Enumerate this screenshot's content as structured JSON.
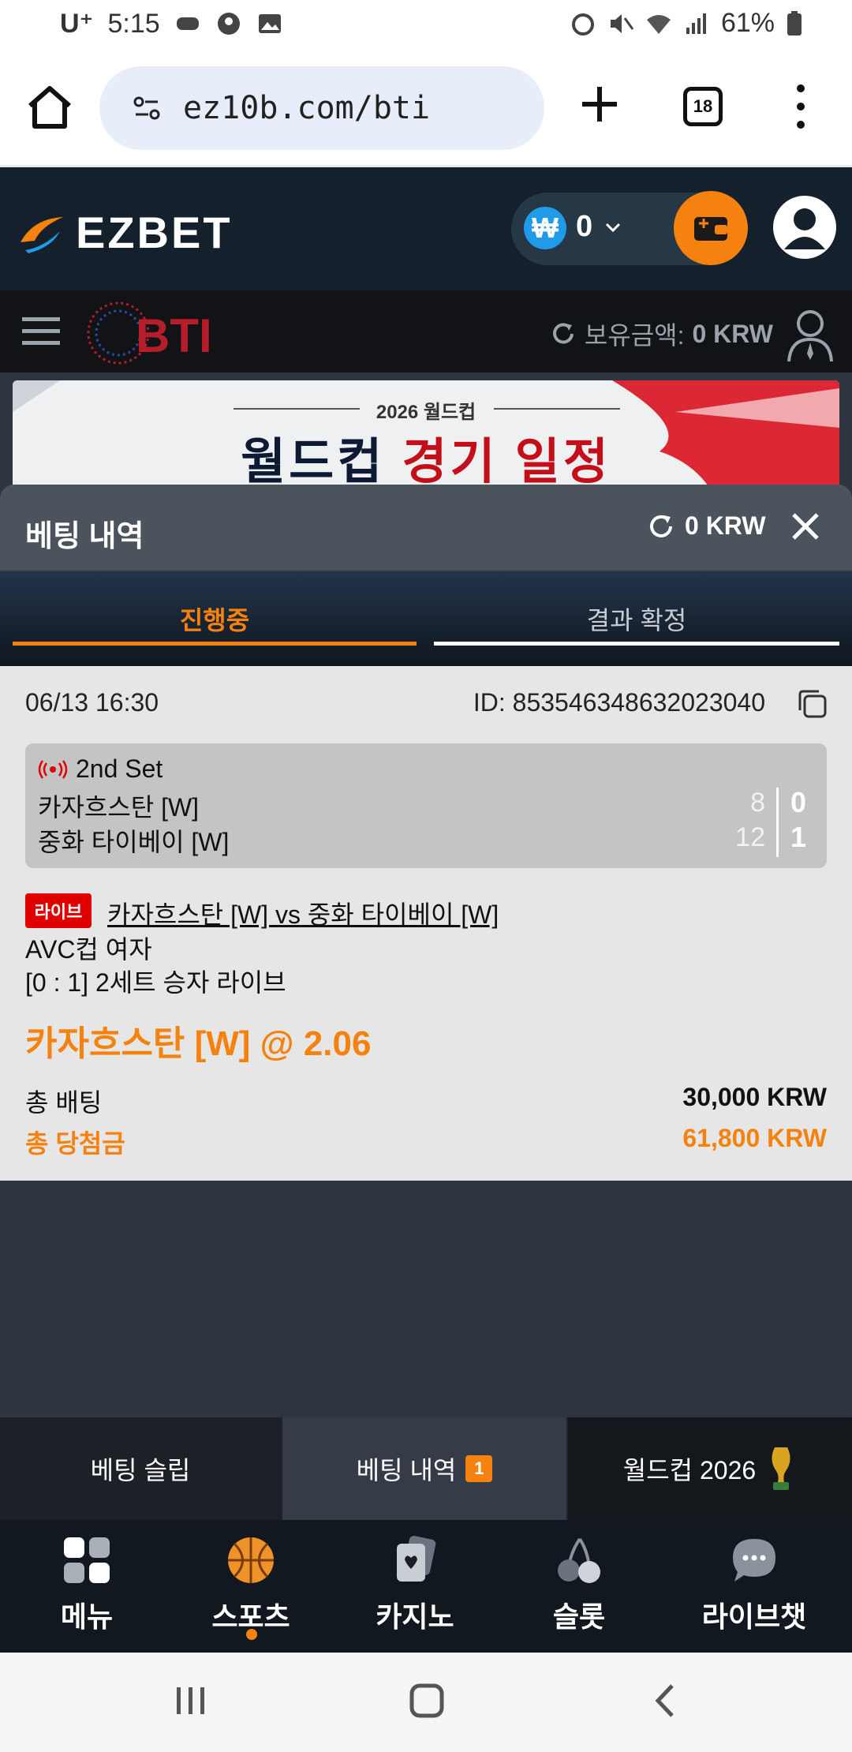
{
  "status_bar": {
    "carrier": "U⁺",
    "time": "5:15",
    "battery": "61%"
  },
  "browser": {
    "url": "ez10b.com/bti",
    "tab_count": "18"
  },
  "site_header": {
    "logo": "EZBET",
    "wallet_balance": "0",
    "wallet_currency_symbol": "₩"
  },
  "bti_bar": {
    "logo": "BTI",
    "balance_label": "보유금액:",
    "balance_value": "0 KRW"
  },
  "banner": {
    "subtitle": "2026 월드컵",
    "title_part1": "월드컵",
    "title_part2": "경기 일정"
  },
  "panel": {
    "title": "베팅 내역",
    "balance": "0 KRW",
    "tabs": [
      {
        "label": "진행중",
        "active": true
      },
      {
        "label": "결과 확정",
        "active": false
      }
    ]
  },
  "bet": {
    "datetime": "06/13 16:30",
    "bet_id": "ID: 853546348632023040",
    "scoreboard": {
      "period": "2nd Set",
      "team1": "카자흐스탄 [W]",
      "team2": "중화 타이베이 [W]",
      "team1_points": "8",
      "team2_points": "12",
      "team1_sets": "0",
      "team2_sets": "1"
    },
    "live_badge": "라이브",
    "match": "카자흐스탄 [W] vs 중화 타이베이 [W]",
    "league": "AVC컵 여자",
    "market": "[0 : 1] 2세트 승자 라이브",
    "selection": "카자흐스탄 [W] @ 2.06",
    "total_stake_label": "총 배팅",
    "total_stake_value": "30,000 KRW",
    "total_payout_label": "총 당첨금",
    "total_payout_value": "61,800 KRW"
  },
  "subtabs": [
    {
      "label": "베팅 슬립"
    },
    {
      "label": "베팅 내역",
      "badge": "1"
    },
    {
      "label": "월드컵 2026"
    }
  ],
  "bottom_nav": [
    {
      "label": "메뉴",
      "icon": "menu-grid-icon"
    },
    {
      "label": "스포츠",
      "icon": "basketball-icon",
      "active": true
    },
    {
      "label": "카지노",
      "icon": "cards-icon"
    },
    {
      "label": "슬롯",
      "icon": "cherry-icon"
    },
    {
      "label": "라이브챗",
      "icon": "chat-bubble-icon"
    }
  ],
  "colors": {
    "accent": "#f5820f",
    "header_bg": "#14202b",
    "live_red": "#e00000"
  }
}
